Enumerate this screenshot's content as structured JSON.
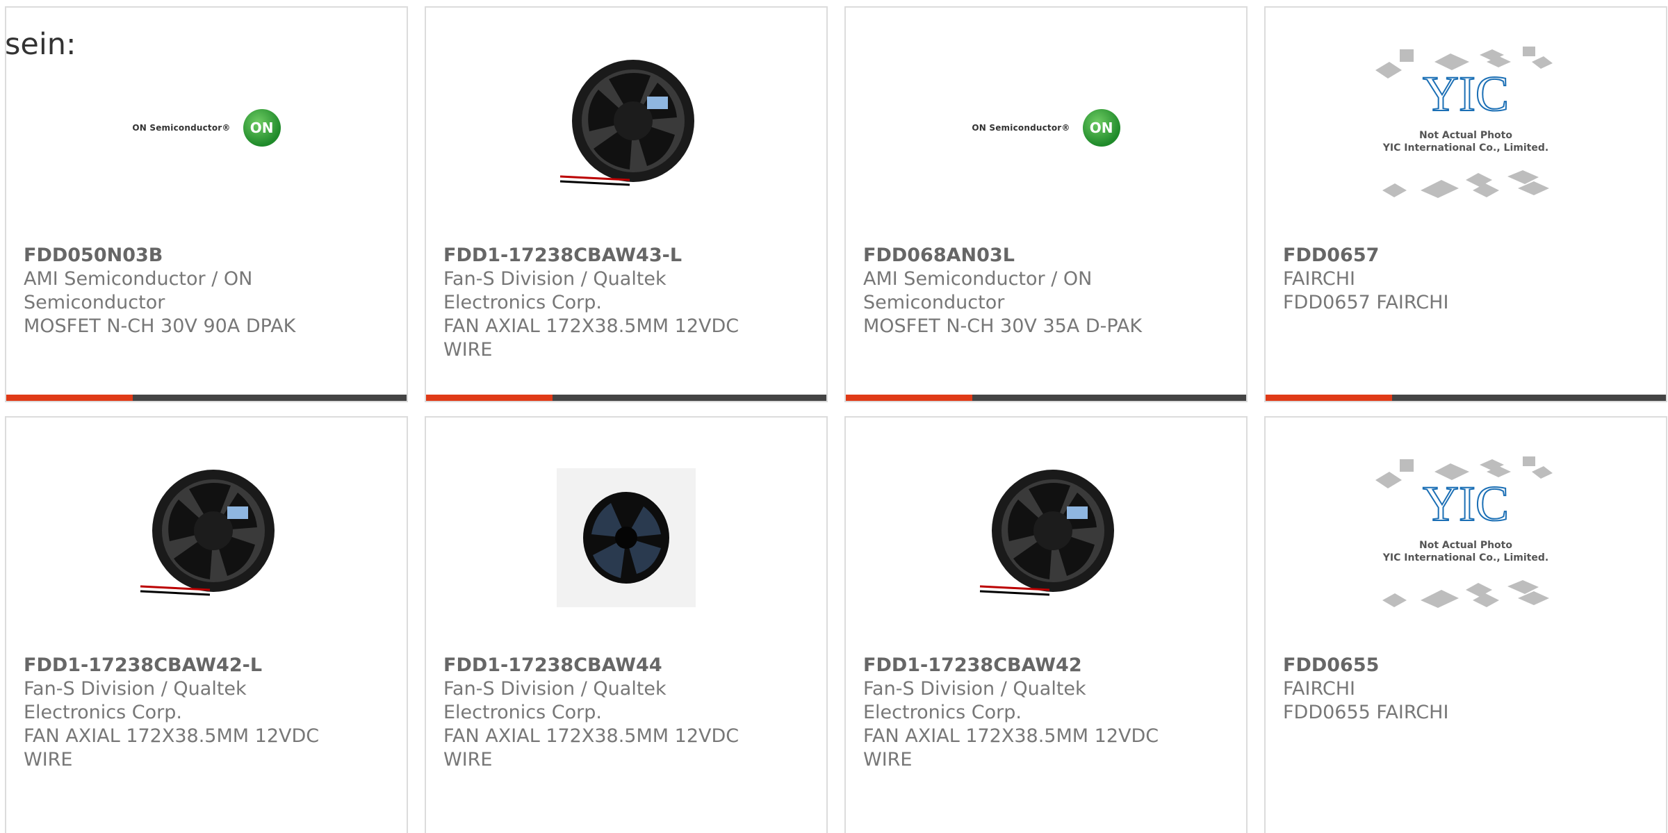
{
  "lead_text": "sein:",
  "products": [
    {
      "part": "FDD050N03B",
      "maker_line1": "AMI Semiconductor / ON",
      "maker_line2": "Semiconductor",
      "desc_line1": "MOSFET N-CH 30V 90A DPAK",
      "desc_line2": "",
      "image": "on-semiconductor-logo"
    },
    {
      "part": "FDD1-17238CBAW43-L",
      "maker_line1": "Fan-S Division / Qualtek",
      "maker_line2": "Electronics Corp.",
      "desc_line1": "FAN AXIAL 172X38.5MM 12VDC",
      "desc_line2": "WIRE",
      "image": "fan-photo"
    },
    {
      "part": "FDD068AN03L",
      "maker_line1": "AMI Semiconductor / ON",
      "maker_line2": "Semiconductor",
      "desc_line1": "MOSFET N-CH 30V 35A D-PAK",
      "desc_line2": "",
      "image": "on-semiconductor-logo"
    },
    {
      "part": "FDD0657",
      "maker_line1": "FAIRCHI",
      "maker_line2": "",
      "desc_line1": "FDD0657 FAIRCHI",
      "desc_line2": "",
      "image": "yic-placeholder"
    },
    {
      "part": "FDD1-17238CBAW42-L",
      "maker_line1": "Fan-S Division / Qualtek",
      "maker_line2": "Electronics Corp.",
      "desc_line1": "FAN AXIAL 172X38.5MM 12VDC",
      "desc_line2": "WIRE",
      "image": "fan-photo"
    },
    {
      "part": "FDD1-17238CBAW44",
      "maker_line1": "Fan-S Division / Qualtek",
      "maker_line2": "Electronics Corp.",
      "desc_line1": "FAN AXIAL 172X38.5MM 12VDC",
      "desc_line2": "WIRE",
      "image": "fan-photo-round"
    },
    {
      "part": "FDD1-17238CBAW42",
      "maker_line1": "Fan-S Division / Qualtek",
      "maker_line2": "Electronics Corp.",
      "desc_line1": "FAN AXIAL 172X38.5MM 12VDC",
      "desc_line2": "WIRE",
      "image": "fan-photo"
    },
    {
      "part": "FDD0655",
      "maker_line1": "FAIRCHI",
      "maker_line2": "",
      "desc_line1": "FDD0655 FAIRCHI",
      "desc_line2": "",
      "image": "yic-placeholder"
    }
  ],
  "logos": {
    "on_text": "ON Semiconductor®",
    "on_mark": "ON",
    "yic_caption_1": "Not Actual Photo",
    "yic_caption_2": "YIC International Co., Limited."
  },
  "colors": {
    "accent": "#e03a17",
    "bar": "#444444",
    "border": "#dcdcdc"
  }
}
